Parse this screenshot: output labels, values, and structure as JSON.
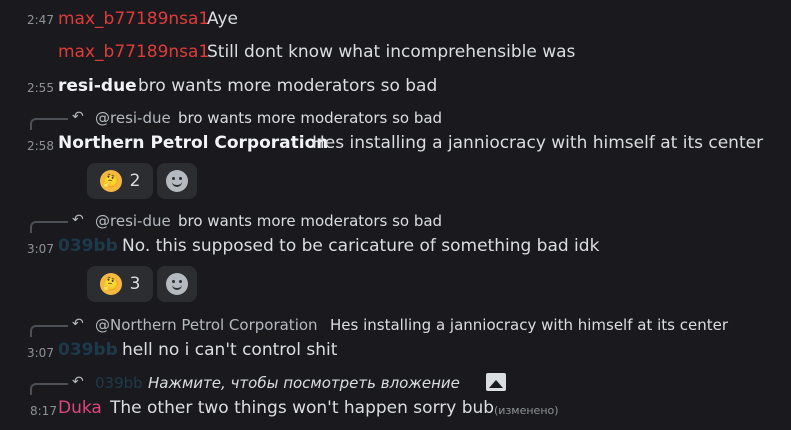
{
  "colors": {
    "bg": "#1a1a1e",
    "username_red": "#e03b3b",
    "username_white": "#f2f3f5",
    "username_pink": "#e0457b",
    "username_hidden": "#1e3a4a",
    "reaction_bg": "#2b2d31"
  },
  "messages": [
    {
      "time": "2:47",
      "author": "max_b77189nsa1",
      "text": "Aye"
    },
    {
      "time": "",
      "author": "max_b77189nsa1",
      "text": "Still dont know what incomprehensible was"
    },
    {
      "time": "2:55",
      "author": "resi-due",
      "text": "bro wants more moderators so bad"
    },
    {
      "time": "2:58",
      "author": "Northern Petrol Corporation",
      "text": "Hes installing a janniocracy with himself at its center",
      "reply": {
        "author": "@resi-due",
        "text": "bro wants more moderators so bad"
      },
      "reaction": {
        "emoji": "thinking-face",
        "count": "2"
      }
    },
    {
      "time": "3:07",
      "author": "039bb",
      "text": "No. this supposed to be caricature of something bad idk",
      "reply": {
        "author": "@resi-due",
        "text": "bro wants more moderators so bad"
      },
      "reaction": {
        "emoji": "thinking-face",
        "count": "3"
      }
    },
    {
      "time": "3:07",
      "author": "039bb",
      "text": "hell no i can't control shit",
      "reply": {
        "author": "@Northern Petrol Corporation",
        "text": "Hes installing a janniocracy with himself at its center"
      }
    },
    {
      "time": "8:17",
      "author": "Duka",
      "text": "The other two things won't happen sorry bub",
      "edited": "(изменено)",
      "reply": {
        "author": "039bb",
        "text": "Нажмите, чтобы посмотреть вложение"
      }
    }
  ]
}
